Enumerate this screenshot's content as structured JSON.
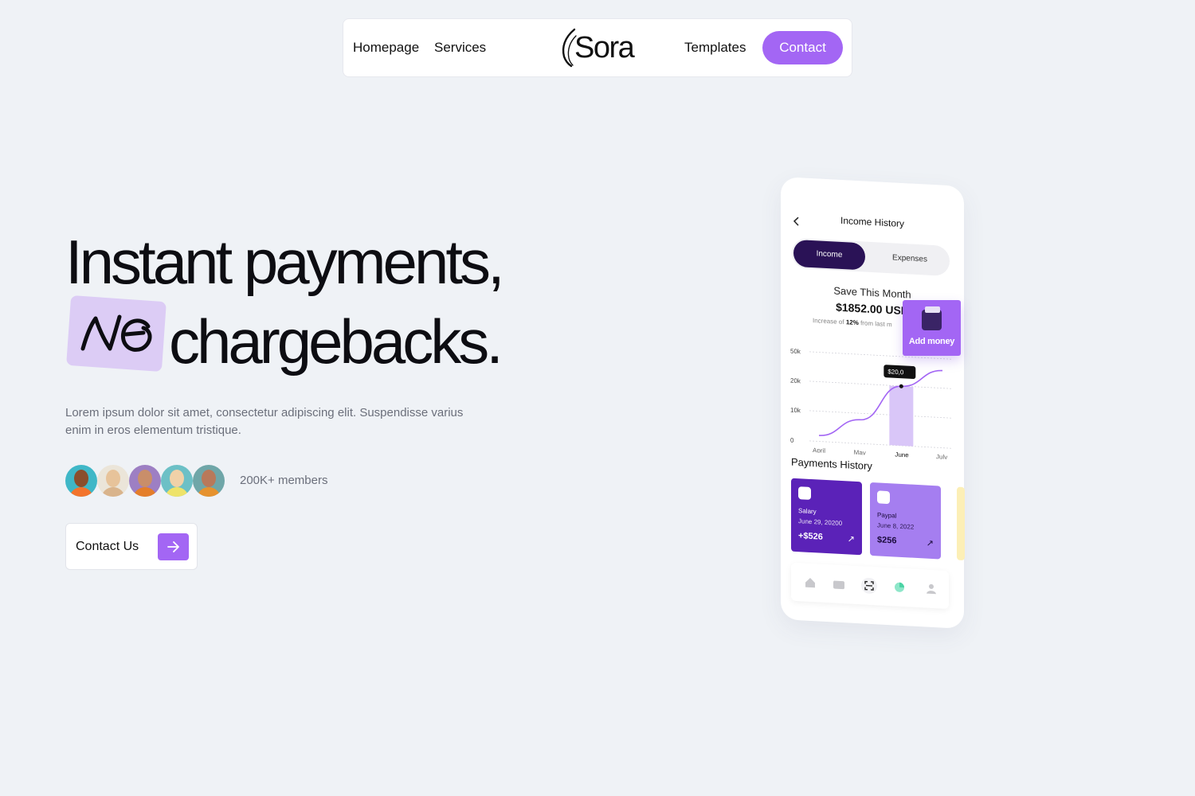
{
  "nav": {
    "links": [
      "Homepage",
      "Services",
      "Templates"
    ],
    "brand": "Sora",
    "contact_label": "Contact"
  },
  "hero": {
    "title_line1": "Instant payments,",
    "no_word": "NO",
    "title_line2": "chargebacks.",
    "description": "Lorem ipsum dolor sit amet, consectetur adipiscing elit. Suspendisse varius enim in eros elementum tristique.",
    "members": "200K+ members",
    "cta_label": "Contact Us"
  },
  "phone": {
    "title": "Income History",
    "tab_active": "Income",
    "tab_inactive": "Expenses",
    "save_label": "Save This Month",
    "amount": "$1852.00 USD",
    "increase_prefix": "Increase of",
    "increase_value": "12%",
    "increase_suffix": "from last m",
    "tooltip": "$20,0",
    "add_money": "Add money",
    "payments_title": "Payments History",
    "cards": [
      {
        "name": "Salary",
        "date": "June 29, 20200",
        "value": "+$526"
      },
      {
        "name": "Paypal",
        "date": "June 8, 2022",
        "value": "$256"
      }
    ]
  },
  "chart_data": {
    "type": "line",
    "categories": [
      "April",
      "May",
      "June",
      "July"
    ],
    "y_ticks": [
      "50k",
      "20k",
      "10k",
      "0"
    ],
    "highlighted_category": "June",
    "series": [
      {
        "values": [
          2,
          8,
          20,
          26
        ]
      }
    ]
  },
  "colors": {
    "accent": "#a366f4",
    "dark_purple": "#2a1256",
    "background": "#eff2f6"
  }
}
